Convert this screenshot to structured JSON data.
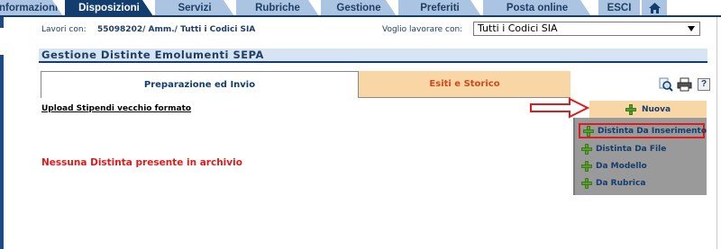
{
  "nav": {
    "tabs": [
      {
        "label": "Informazioni",
        "active": false
      },
      {
        "label": "Disposizioni",
        "active": true
      },
      {
        "label": "Servizi",
        "active": false
      },
      {
        "label": "Rubriche",
        "active": false
      },
      {
        "label": "Gestione",
        "active": false
      },
      {
        "label": "Preferiti",
        "active": false
      },
      {
        "label": "Posta online",
        "active": false
      },
      {
        "label": "ESCI",
        "active": false
      }
    ],
    "home_icon": "home-icon"
  },
  "context": {
    "lavori_label": "Lavori con:",
    "lavori_value": "55098202/ Amm./ Tutti i Codici SIA",
    "voglio_label": "Voglio lavorare con:",
    "voglio_selected": "Tutti i Codici SIA"
  },
  "page_title": "Gestione Distinte Emolumenti SEPA",
  "content_tabs": {
    "prep_label": "Preparazione ed Invio",
    "esiti_label": "Esiti e Storico"
  },
  "toolbar": {
    "search_icon": "search-icon",
    "print_icon": "print-icon",
    "help_label": "?"
  },
  "upload_link": "Upload Stipendi vecchio formato",
  "nuova": {
    "label": "Nuova",
    "menu": [
      "Distinta Da Inserimento",
      "Distinta Da File",
      "Da Modello",
      "Da Rubrica"
    ]
  },
  "empty_message": "Nessuna Distinta presente in archivio",
  "colors": {
    "nav_active": "#123d6e",
    "nav_inactive": "#aac4e2",
    "tab_esiti_bg": "#f9d6a6",
    "error_red": "#e01b1b",
    "menu_bg": "#9a9a9a"
  }
}
